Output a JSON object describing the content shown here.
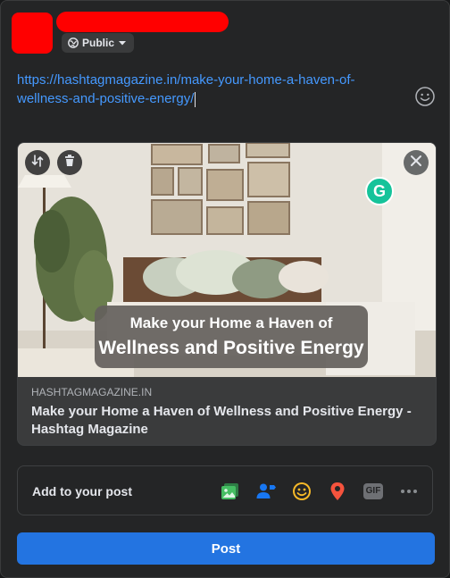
{
  "composer": {
    "privacy_label": "Public",
    "post_text": "https://hashtagmagazine.in/make-your-home-a-haven-of-wellness-and-positive-energy/"
  },
  "link_preview": {
    "image_caption_line1": "Make your Home a Haven of",
    "image_caption_line2": "Wellness and Positive Energy",
    "domain": "HASHTAGMAGAZINE.IN",
    "title": "Make your Home a Haven of Wellness and Positive Energy - Hashtag Magazine",
    "grammarly_letter": "G"
  },
  "add_to_post": {
    "label": "Add to your post",
    "icons": [
      "photo-video-icon",
      "tag-people-icon",
      "feeling-icon",
      "check-in-icon",
      "gif-icon",
      "more-icon"
    ],
    "gif_label": "GIF"
  },
  "post_button": {
    "label": "Post"
  },
  "colors": {
    "accent": "#2374e1",
    "link": "#4599ff",
    "photo_green": "#45bd62",
    "tag_blue": "#1877f2",
    "feeling_yellow": "#f7b928",
    "checkin_red": "#f5533d"
  }
}
